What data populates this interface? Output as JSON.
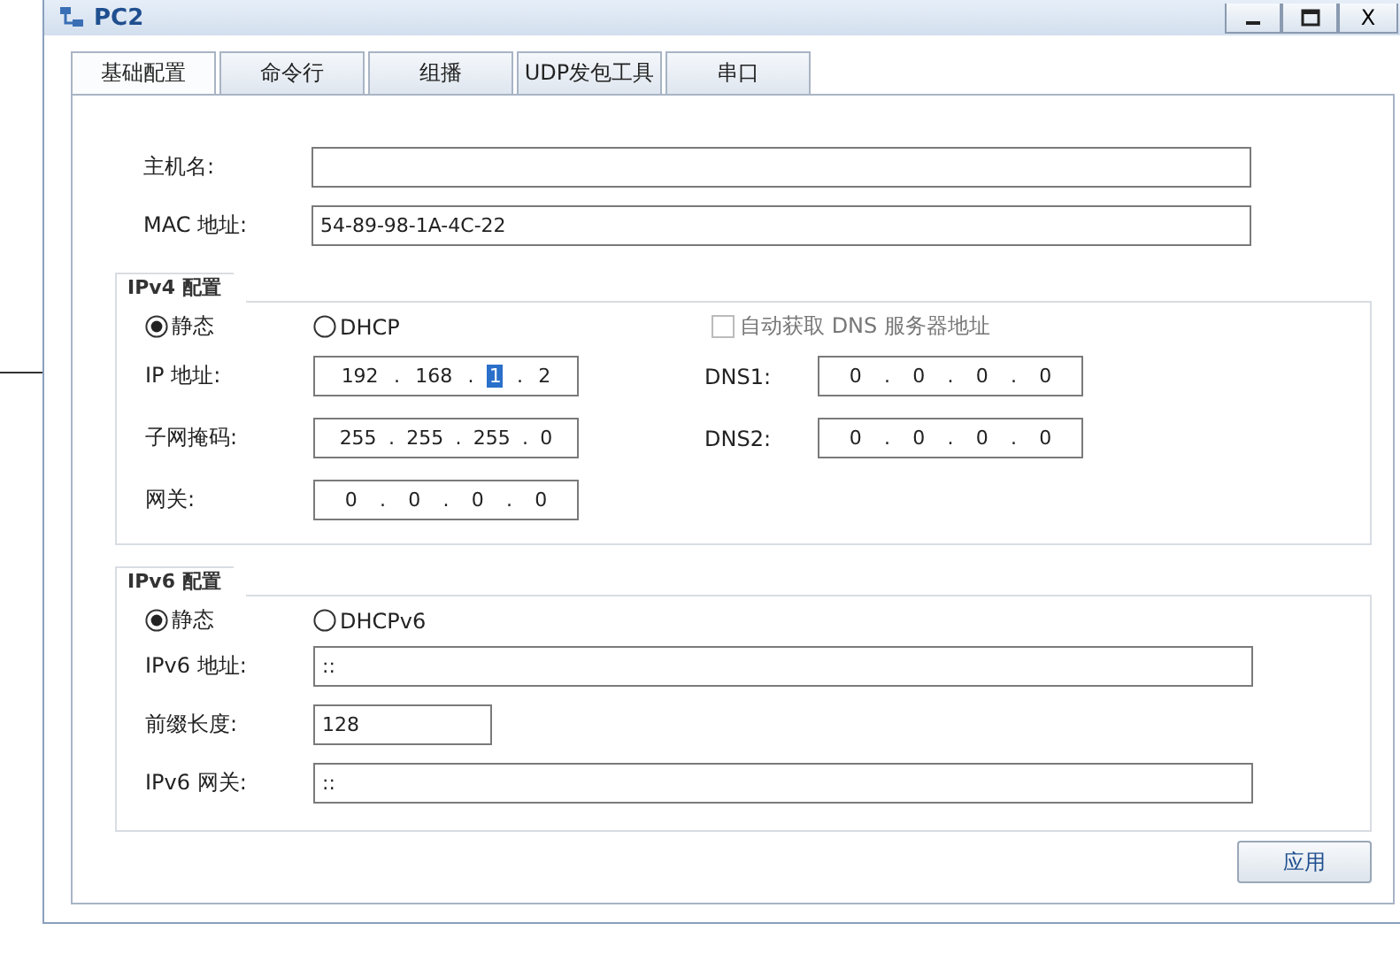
{
  "window": {
    "title": "PC2",
    "controls": [
      {
        "kind": "minimize"
      },
      {
        "kind": "maximize"
      },
      {
        "kind": "close",
        "label": "X"
      }
    ]
  },
  "tabs": [
    {
      "label": "基础配置",
      "selected": true
    },
    {
      "label": "命令行",
      "selected": false
    },
    {
      "label": "组播",
      "selected": false
    },
    {
      "label": "UDP发包工具",
      "selected": false
    },
    {
      "label": "串口",
      "selected": false
    }
  ],
  "host": {
    "hostname_label": "主机名:",
    "mac_label": "MAC 地址:",
    "mac": "54-89-98-1A-4C-22"
  },
  "ipv4": {
    "title": "IPv4 配置",
    "modes": [
      {
        "label": "静态",
        "selected": true
      },
      {
        "label": "DHCP",
        "selected": false
      }
    ],
    "auto_dns": {
      "label": "自动获取 DNS 服务器地址",
      "checked": false,
      "disabled": true
    },
    "ip": {
      "label": "IP 地址:",
      "separators": [
        ".",
        ".",
        "."
      ],
      "octets": [
        {
          "text": "192",
          "selected": false
        },
        {
          "text": "168",
          "selected": false
        },
        {
          "text": "1",
          "selected": true
        },
        {
          "text": "2",
          "selected": false
        }
      ]
    },
    "mask": {
      "label": "子网掩码:",
      "separators": [
        ".",
        ".",
        "."
      ],
      "octets": [
        {
          "text": "255",
          "selected": false
        },
        {
          "text": "255",
          "selected": false
        },
        {
          "text": "255",
          "selected": false
        },
        {
          "text": "0",
          "selected": false
        }
      ]
    },
    "gateway": {
      "label": "网关:",
      "separators": [
        ".",
        ".",
        "."
      ],
      "octets": [
        {
          "text": "0",
          "selected": false
        },
        {
          "text": "0",
          "selected": false
        },
        {
          "text": "0",
          "selected": false
        },
        {
          "text": "0",
          "selected": false
        }
      ]
    },
    "dns1": {
      "label": "DNS1:",
      "separators": [
        ".",
        ".",
        "."
      ],
      "octets": [
        {
          "text": "0",
          "selected": false
        },
        {
          "text": "0",
          "selected": false
        },
        {
          "text": "0",
          "selected": false
        },
        {
          "text": "0",
          "selected": false
        }
      ]
    },
    "dns2": {
      "label": "DNS2:",
      "separators": [
        ".",
        ".",
        "."
      ],
      "octets": [
        {
          "text": "0",
          "selected": false
        },
        {
          "text": "0",
          "selected": false
        },
        {
          "text": "0",
          "selected": false
        },
        {
          "text": "0",
          "selected": false
        }
      ]
    }
  },
  "ipv6": {
    "title": "IPv6 配置",
    "modes": [
      {
        "label": "静态",
        "selected": true
      },
      {
        "label": "DHCPv6",
        "selected": false
      }
    ],
    "address_label": "IPv6 地址:",
    "address": "::",
    "prefix_label": "前缀长度:",
    "prefix": "128",
    "gateway_label": "IPv6 网关:",
    "gateway": "::"
  },
  "apply_button": "应用"
}
